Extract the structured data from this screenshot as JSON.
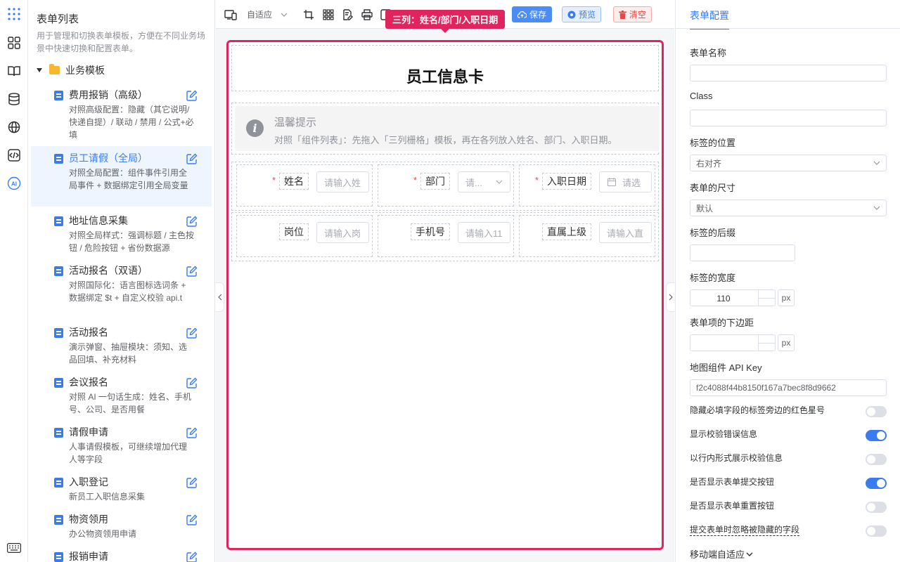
{
  "template_panel": {
    "title": "表单列表",
    "description": "用于管理和切换表单模板，方便在不同业务场景中快速切换和配置表单。",
    "group_label": "业务模板",
    "items": [
      {
        "name": "费用报销（高级）",
        "desc": "对照高级配置：隐藏（其它说明/快递自提）/ 联动 / 禁用 / 公式+必填"
      },
      {
        "name": "员工请假（全局）",
        "desc": "对照全局配置：组件事件引用全局事件 + 数据绑定引用全局变量"
      },
      {
        "name": "地址信息采集",
        "desc": "对照全局样式：强调标题 / 主色按钮 / 危险按钮 + 省份数据源"
      },
      {
        "name": "活动报名（双语）",
        "desc": "对照国际化：语言图标选词条 + 数据绑定 $t + 自定义校验 api.t"
      },
      {
        "name": "活动报名",
        "desc": "演示弹窗、抽屉模块：须知、选品回填、补充材料"
      },
      {
        "name": "会议报名",
        "desc": "对照 AI 一句话生成：姓名、手机号、公司、是否用餐"
      },
      {
        "name": "请假申请",
        "desc": "人事请假模板，可继续增加代理人等字段"
      },
      {
        "name": "入职登记",
        "desc": "新员工入职信息采集"
      },
      {
        "name": "物资领用",
        "desc": "办公物资领用申请"
      },
      {
        "name": "报销申请",
        "desc": ""
      }
    ]
  },
  "toolbar": {
    "adapt_label": "自适应",
    "save_label": "保存",
    "preview_label": "预览",
    "clear_label": "清空"
  },
  "canvas": {
    "selection_tag": "三列：姓名/部门/入职日期",
    "form_title": "员工信息卡",
    "alert_title": "温馨提示",
    "alert_desc": "对照「组件列表」：先拖入「三列栅格」模板，再在各列放入姓名、部门、入职日期。",
    "row1": [
      {
        "label": "姓名",
        "placeholder": "请输入姓",
        "required": true
      },
      {
        "label": "部门",
        "placeholder": "请...",
        "required": true
      },
      {
        "label": "入职日期",
        "placeholder": "请选",
        "required": true
      }
    ],
    "row2": [
      {
        "label": "岗位",
        "placeholder": "请输入岗"
      },
      {
        "label": "手机号",
        "placeholder": "请输入11"
      },
      {
        "label": "直属上级",
        "placeholder": "请输入直"
      }
    ],
    "required_mark": "*"
  },
  "config": {
    "tab_label": "表单配置",
    "form_name_label": "表单名称",
    "form_name_value": "",
    "class_label": "Class",
    "class_value": "",
    "label_position_label": "标签的位置",
    "label_position_value": "右对齐",
    "form_size_label": "表单的尺寸",
    "form_size_value": "默认",
    "label_suffix_label": "标签的后缀",
    "label_suffix_value": "",
    "label_width_label": "标签的宽度",
    "label_width_value": "110",
    "unit": "px",
    "item_margin_label": "表单项的下边距",
    "item_margin_value": "",
    "map_key_label": "地图组件 API Key",
    "map_key_value": "f2c4088f44b8150f167a7bec8f8d9662",
    "switches": [
      {
        "label": "隐藏必填字段的标签旁边的红色星号",
        "on": false
      },
      {
        "label": "显示校验错误信息",
        "on": true
      },
      {
        "label": "以行内形式展示校验信息",
        "on": false
      },
      {
        "label": "是否显示表单提交按钮",
        "on": true
      },
      {
        "label": "是否显示表单重置按钮",
        "on": false
      },
      {
        "label": "提交表单时忽略被隐藏的字段",
        "on": false
      }
    ],
    "mobile_adapt_label": "移动端自适应"
  },
  "colors": {
    "primary": "#3a7bf0",
    "danger": "#e0245e",
    "folder": "#f5b82e"
  }
}
